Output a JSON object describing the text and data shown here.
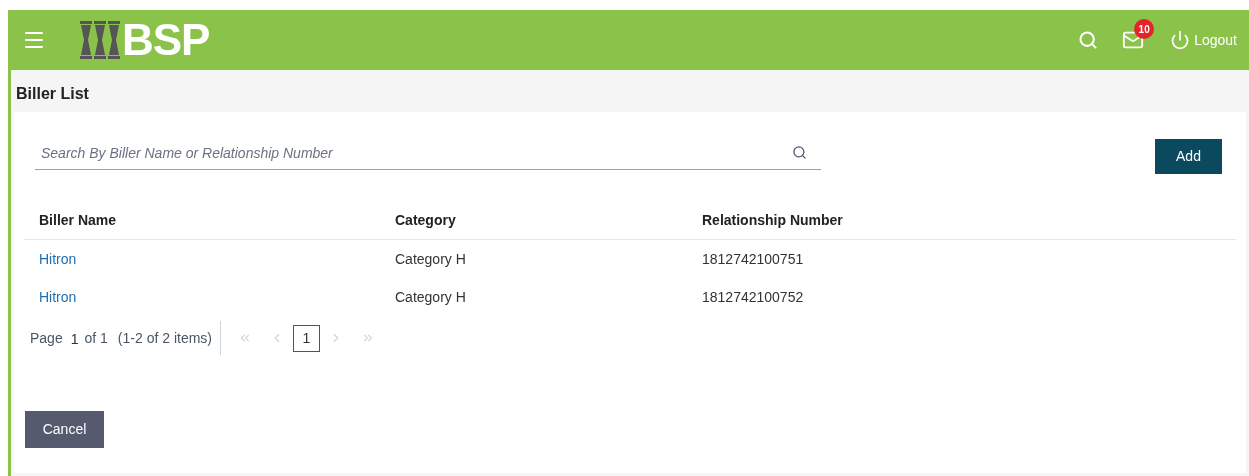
{
  "header": {
    "logo": "BSP",
    "mail_badge": "10",
    "logout": "Logout"
  },
  "page_title": "Biller List",
  "search": {
    "placeholder": "Search By Biller Name or Relationship Number"
  },
  "add_button": "Add",
  "table": {
    "columns": [
      "Biller Name",
      "Category",
      "Relationship Number"
    ],
    "rows": [
      {
        "name": "Hitron",
        "category": "Category H",
        "relationship": "1812742100751"
      },
      {
        "name": "Hitron",
        "category": "Category H",
        "relationship": "1812742100752"
      }
    ]
  },
  "pagination": {
    "label": "Page",
    "page": "1",
    "of": "of 1",
    "summary": "(1-2 of 2 items)",
    "pages": [
      {
        "label": "1",
        "selected": true
      }
    ],
    "first_disabled": true,
    "prev_disabled": true,
    "next_disabled": true,
    "last_disabled": true
  },
  "cancel_button": "Cancel"
}
